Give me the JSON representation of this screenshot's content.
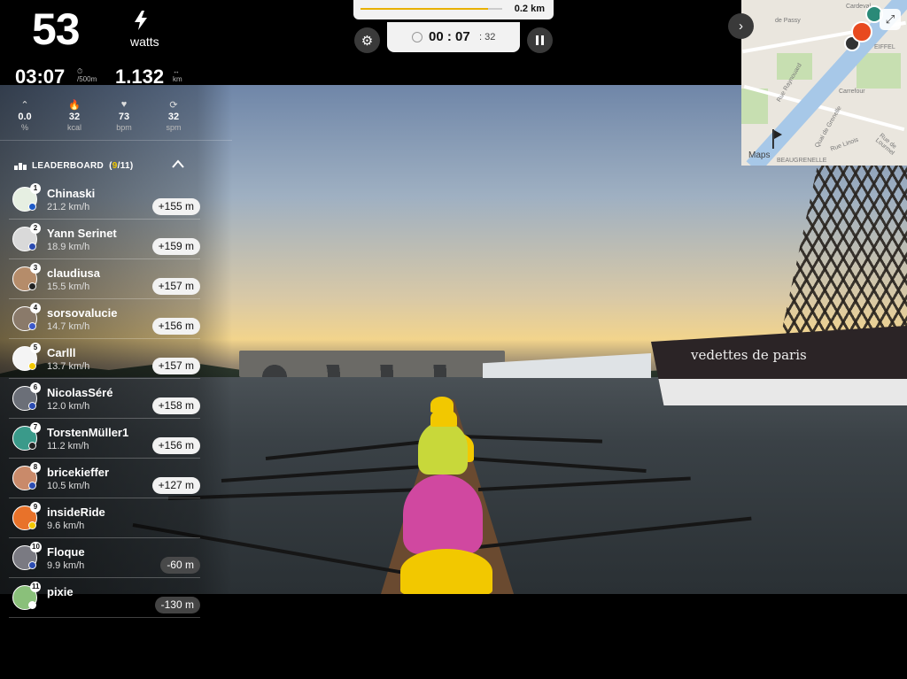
{
  "metrics": {
    "power_value": "53",
    "power_unit": "watts",
    "split_value": "03:07",
    "split_unit_top": "⏱",
    "split_unit_bottom": "/500m",
    "distance_value": "1.132",
    "distance_unit_top": "↔",
    "distance_unit_bottom": "km"
  },
  "stats": [
    {
      "icon": "incline-icon",
      "glyph": "⌃",
      "value": "0.0",
      "unit": "%"
    },
    {
      "icon": "flame-icon",
      "glyph": "🔥",
      "value": "32",
      "unit": "kcal"
    },
    {
      "icon": "heart-icon",
      "glyph": "♥",
      "value": "73",
      "unit": "bpm"
    },
    {
      "icon": "cycle-icon",
      "glyph": "⟳",
      "value": "32",
      "unit": "spm"
    }
  ],
  "route_progress": {
    "remaining_label": "0.2 km",
    "fraction": 0.9
  },
  "timer": {
    "main": "00 : 07",
    "sub": ": 32"
  },
  "map": {
    "attribution": "Maps",
    "labels": [
      "de Passy",
      "Rue Raynouard",
      "Carrefour",
      "BEAUGRENELLE",
      "EIFFEL",
      "Quai de Grenelle",
      "Rue de Lourmel",
      "Rue Linois",
      "Cardeval"
    ]
  },
  "leaderboard": {
    "title": "LEADERBOARD",
    "count_open": "(",
    "position": "9",
    "count_rest": "/11)",
    "entries": [
      {
        "rank": "1",
        "name": "Chinaski",
        "speed": "21.2 km/h",
        "gap": "+155 m",
        "ahead": true,
        "avatar_color": "#e6efe2",
        "flag_color": "#1e5bc6"
      },
      {
        "rank": "2",
        "name": "Yann Serinet",
        "speed": "18.9 km/h",
        "gap": "+159 m",
        "ahead": true,
        "avatar_color": "#d9d9d9",
        "flag_color": "#2b4bb0"
      },
      {
        "rank": "3",
        "name": "claudiusa",
        "speed": "15.5 km/h",
        "gap": "+157 m",
        "ahead": true,
        "avatar_color": "#b58c6a",
        "flag_color": "#222"
      },
      {
        "rank": "4",
        "name": "sorsovalucie",
        "speed": "14.7 km/h",
        "gap": "+156 m",
        "ahead": true,
        "avatar_color": "#8a7a6a",
        "flag_color": "#3b58c9"
      },
      {
        "rank": "5",
        "name": "Carlll",
        "speed": "13.7 km/h",
        "gap": "+157 m",
        "ahead": true,
        "avatar_color": "#f4f4f4",
        "flag_color": "#f2c800"
      },
      {
        "rank": "6",
        "name": "NicolasSéré",
        "speed": "12.0 km/h",
        "gap": "+158 m",
        "ahead": true,
        "avatar_color": "#6b6f78",
        "flag_color": "#2b4bb0"
      },
      {
        "rank": "7",
        "name": "TorstenMüller1",
        "speed": "11.2 km/h",
        "gap": "+156 m",
        "ahead": true,
        "avatar_color": "#3a9a8a",
        "flag_color": "#222"
      },
      {
        "rank": "8",
        "name": "bricekieffer",
        "speed": "10.5 km/h",
        "gap": "+127 m",
        "ahead": true,
        "avatar_color": "#c98a6a",
        "flag_color": "#2b4bb0"
      },
      {
        "rank": "9",
        "name": "insideRide",
        "speed": "9.6 km/h",
        "gap": "",
        "ahead": false,
        "avatar_color": "#e8722a",
        "flag_color": "#f2c800"
      },
      {
        "rank": "10",
        "name": "Floque",
        "speed": "9.9 km/h",
        "gap": "-60 m",
        "ahead": false,
        "avatar_color": "#7a7a82",
        "flag_color": "#2b4bb0"
      },
      {
        "rank": "11",
        "name": "pixie",
        "speed": "",
        "gap": "-130 m",
        "ahead": false,
        "avatar_color": "#8ac07a",
        "flag_color": "#fff"
      }
    ]
  },
  "scene": {
    "boat_name": "vedettes de paris"
  },
  "colors": {
    "accent": "#f2c800",
    "panel_chip_ahead": "#f2f2f2",
    "panel_chip_behind": "#505050"
  }
}
